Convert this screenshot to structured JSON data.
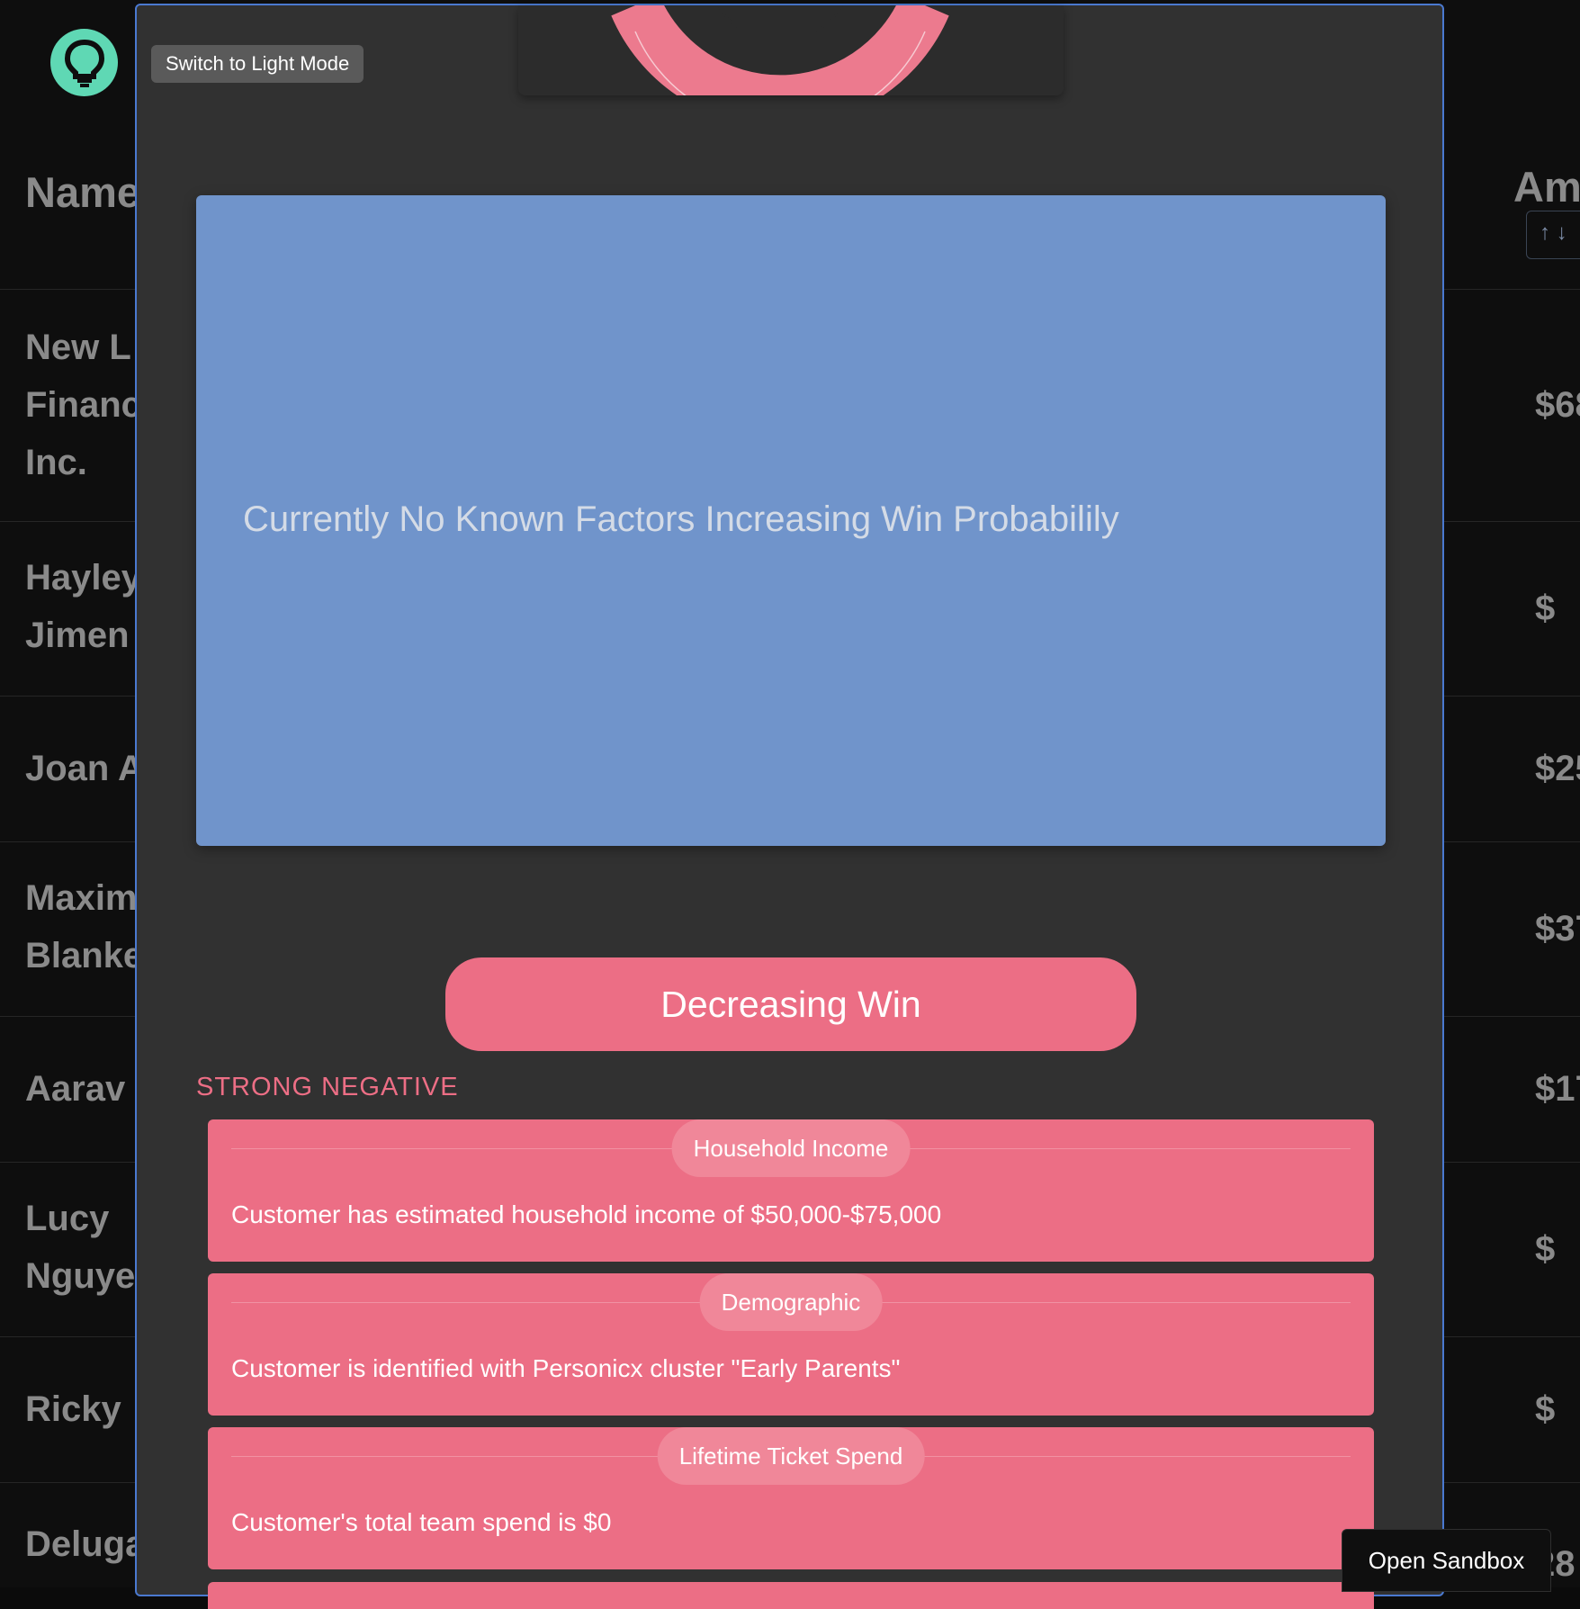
{
  "app": {
    "theme_toggle_label": "Switch to Light Mode",
    "sandbox_label": "Open Sandbox",
    "logo_icon": "lightbulb-icon"
  },
  "table": {
    "headers": {
      "name": "Name",
      "amount": "Am"
    },
    "rows": [
      {
        "name": "New L\nFinanc\nInc.",
        "amount": "$68"
      },
      {
        "name": "Hayley\nJimen",
        "amount": "$"
      },
      {
        "name": "Joan A",
        "amount": "$25"
      },
      {
        "name": "Maxim\nBlanke",
        "amount": "$37"
      },
      {
        "name": "Aarav",
        "amount": "$17"
      },
      {
        "name": "Lucy\nNguye",
        "amount": "$"
      },
      {
        "name": "Ricky",
        "amount": "$"
      },
      {
        "name": "Deluga",
        "amount": "28"
      }
    ]
  },
  "modal": {
    "positive_panel": {
      "empty_message": "Currently No Known Factors Increasing Win Probabilily",
      "color": "#7094cb"
    },
    "negative_section": {
      "button_label": "Decreasing Win",
      "strength_label": "STRONG NEGATIVE",
      "color": "#ec6e85",
      "factors": [
        {
          "category": "Household Income",
          "description": "Customer has estimated household income of $50,000-$75,000"
        },
        {
          "category": "Demographic",
          "description": "Customer is identified with Personicx cluster \"Early Parents\""
        },
        {
          "category": "Lifetime Ticket Spend",
          "description": "Customer's total team spend is $0"
        }
      ]
    }
  },
  "colors": {
    "accent_pink": "#ec6e85",
    "accent_blue": "#7094cb",
    "modal_bg": "#313131",
    "logo_green": "#5fd8b4"
  }
}
